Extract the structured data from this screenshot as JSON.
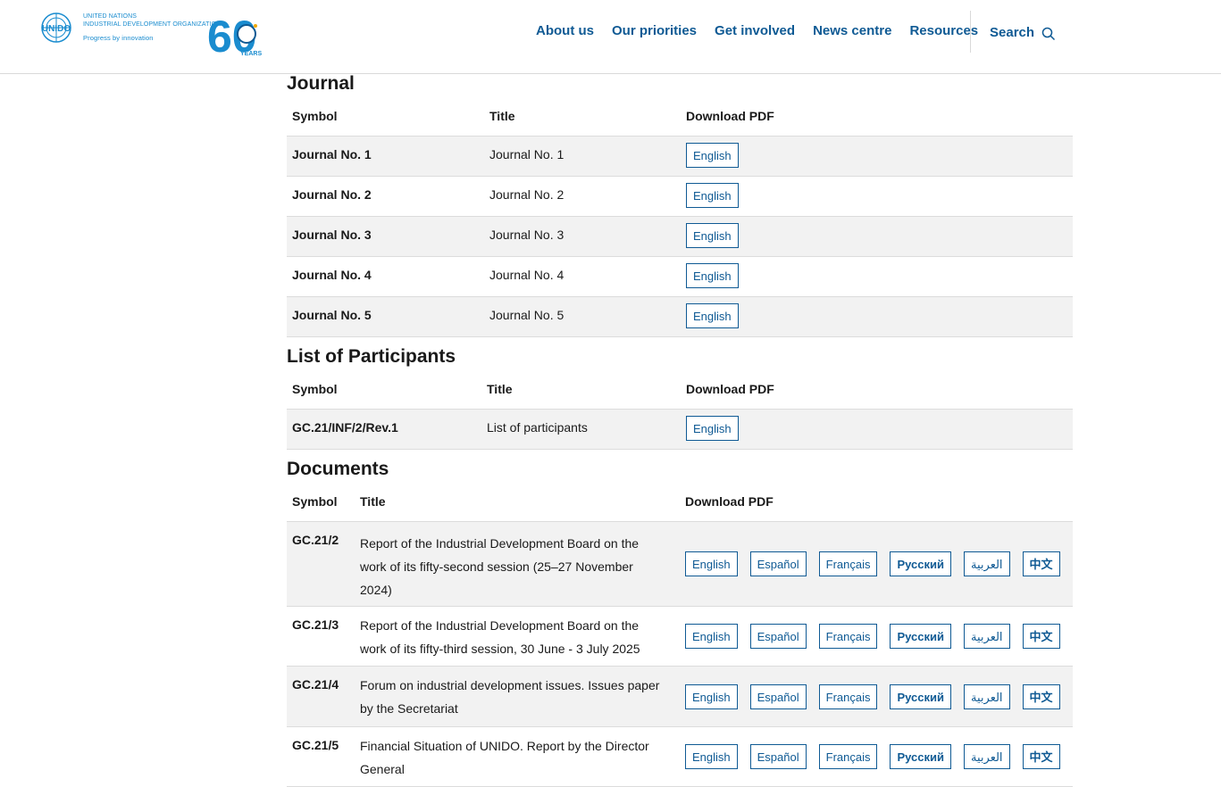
{
  "logo": {
    "org_line1": "UNITED NATIONS",
    "org_line2": "INDUSTRIAL DEVELOPMENT ORGANIZATION",
    "tagline": "Progress by innovation",
    "emblem_text": "UNIDO",
    "anniversary": "60",
    "anniversary_label": "YEARS"
  },
  "nav": [
    "About us",
    "Our priorities",
    "Get involved",
    "News centre",
    "Resources"
  ],
  "search": {
    "label": "Search"
  },
  "journal": {
    "title": "Journal",
    "headers": [
      "Symbol",
      "Title",
      "Download PDF"
    ],
    "rows": [
      {
        "symbol": "Journal No. 1",
        "title": "Journal No. 1",
        "download": "English"
      },
      {
        "symbol": "Journal No. 2",
        "title": "Journal No. 2",
        "download": "English"
      },
      {
        "symbol": "Journal No. 3",
        "title": "Journal No. 3",
        "download": "English"
      },
      {
        "symbol": "Journal No. 4",
        "title": "Journal No. 4",
        "download": "English"
      },
      {
        "symbol": "Journal No. 5",
        "title": "Journal No. 5",
        "download": "English"
      }
    ]
  },
  "participants": {
    "title": "List of Participants",
    "headers": [
      "Symbol",
      "Title",
      "Download PDF"
    ],
    "rows": [
      {
        "symbol": "GC.21/INF/2/Rev.1",
        "title": "List of participants",
        "download": "English"
      }
    ]
  },
  "documents": {
    "title": "Documents",
    "headers": [
      "Symbol",
      "Title",
      "Download PDF"
    ],
    "languages": [
      "English",
      "Español",
      "Français",
      "Русский",
      "العربية",
      "中文"
    ],
    "rows": [
      {
        "symbol": "GC.21/2",
        "title": "Report of the Industrial Development Board on the work of its fifty-second session (25–27 November 2024)"
      },
      {
        "symbol": "GC.21/3",
        "title": "Report of the Industrial Development Board on the work of its fifty-third session, 30 June - 3 July 2025"
      },
      {
        "symbol": "GC.21/4",
        "title": "Forum on industrial development issues. Issues paper by the Secretariat"
      },
      {
        "symbol": "GC.21/5",
        "title": "Financial Situation of UNIDO. Report by the Director General"
      }
    ]
  },
  "colors": {
    "link": "#0f5a94",
    "logo_blue": "#1a8ccf",
    "row_alt": "#f2f2f2"
  }
}
